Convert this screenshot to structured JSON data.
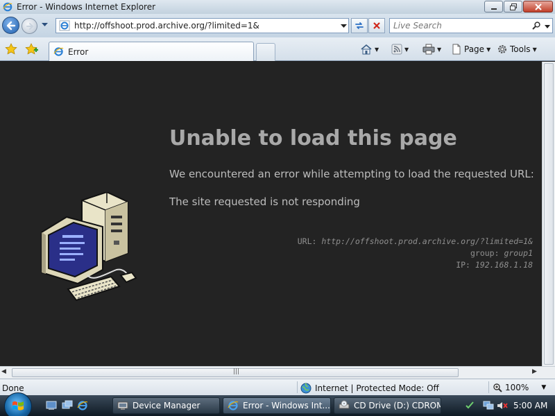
{
  "window": {
    "title": "Error - Windows Internet Explorer"
  },
  "address_bar": {
    "url": "http://offshoot.prod.archive.org/?limited=1&"
  },
  "search": {
    "placeholder": "Live Search"
  },
  "tab": {
    "label": "Error"
  },
  "command_bar": {
    "page_label": "Page",
    "tools_label": "Tools"
  },
  "error_page": {
    "title": "Unable to load this page",
    "message": "We encountered an error while attempting to load the requested URL:",
    "reason": "The site requested is not responding",
    "url_label": "URL:",
    "url_value": "http://offshoot.prod.archive.org/?limited=1&",
    "group_label": "group:",
    "group_value": "group1",
    "ip_label": "IP:",
    "ip_value": "192.168.1.18"
  },
  "status_bar": {
    "status": "Done",
    "zone": "Internet | Protected Mode: Off",
    "zoom": "100%"
  },
  "taskbar": {
    "items": [
      {
        "label": "Device Manager"
      },
      {
        "label": "Error - Windows Int..."
      },
      {
        "label": "CD Drive (D:) CDROM"
      }
    ],
    "clock": "5:00 AM"
  }
}
